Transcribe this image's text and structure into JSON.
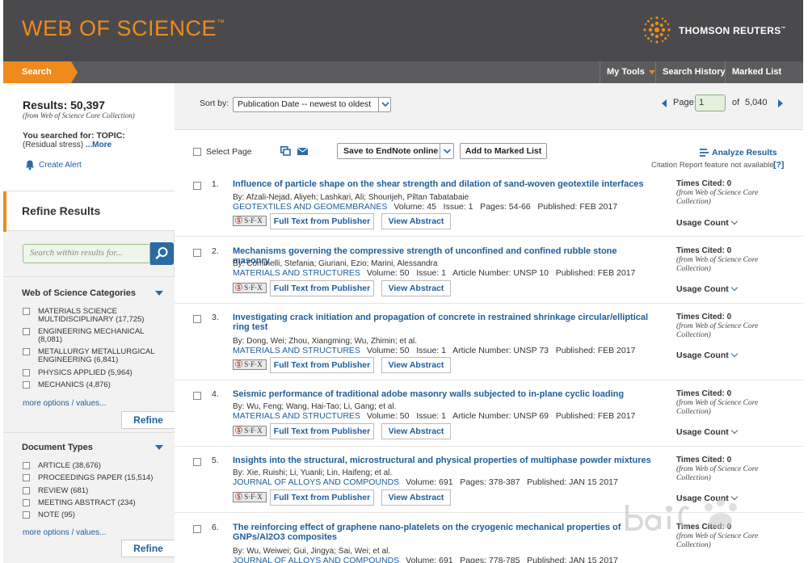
{
  "header": {
    "logo": "WEB OF SCIENCE",
    "logo_tm": "™",
    "publisher": "THOMSON REUTERS",
    "publisher_tm": "™"
  },
  "nav": {
    "search_tab": "Search",
    "my_tools": "My Tools",
    "search_history": "Search History",
    "marked_list": "Marked List"
  },
  "sidebar": {
    "results_label": "Results: 50,397",
    "results_from": "(from Web of Science Core Collection)",
    "searched_for": "You searched for: TOPIC:",
    "search_query": "(Residual stress)",
    "more_link": "...More",
    "create_alert": "Create Alert",
    "refine_title": "Refine Results",
    "within_placeholder": "Search within results for...",
    "categories": {
      "title": "Web of Science Categories",
      "items": [
        "MATERIALS SCIENCE MULTIDISCIPLINARY (17,725)",
        "ENGINEERING MECHANICAL (8,081)",
        "METALLURGY METALLURGICAL ENGINEERING (6,841)",
        "PHYSICS APPLIED (5,964)",
        "MECHANICS (4,876)"
      ],
      "more": "more options / values...",
      "refine": "Refine"
    },
    "doc_types": {
      "title": "Document Types",
      "items": [
        "ARTICLE (38,676)",
        "PROCEEDINGS PAPER (15,514)",
        "REVIEW (681)",
        "MEETING ABSTRACT (234)",
        "NOTE (95)"
      ],
      "more": "more options / values...",
      "refine": "Refine"
    }
  },
  "sort": {
    "label": "Sort by:",
    "selected": "Publication Date -- newest to oldest"
  },
  "pager": {
    "page_label": "Page",
    "current": "1",
    "of_label": "of",
    "total": "5,040"
  },
  "toolbar": {
    "select_page": "Select Page",
    "endnote": "Save to EndNote online",
    "marked_list": "Add to Marked List",
    "analyze": "Analyze Results",
    "citation_note": "Citation Report feature not available.",
    "help": "[?]"
  },
  "record_common": {
    "sfx": "S·F·X",
    "full_text": "Full Text from Publisher",
    "view_abstract": "View Abstract",
    "cited_from": "(from Web of Science Core Collection)",
    "usage_count": "Usage Count"
  },
  "records": [
    {
      "num": "1.",
      "title": "Influence of particle shape on the shear strength and dilation of sand-woven geotextile interfaces",
      "authors": "By: Afzali-Nejad, Aliyeh; Lashkari, Ali; Shourijeh, Piltan Tabatabaie",
      "journal": "GEOTEXTILES AND GEOMEMBRANES",
      "details": "Volume: 45   Issue: 1   Pages: 54-66   Published: FEB 2017",
      "cited": "Times Cited: 0"
    },
    {
      "num": "2.",
      "title": "Mechanisms governing the compressive strength of unconfined and confined rubble stone masonry",
      "authors": "By: Cominelli, Stefania; Giuriani, Ezio; Marini, Alessandra",
      "journal": "MATERIALS AND STRUCTURES",
      "details": "Volume: 50   Issue: 1   Article Number: UNSP 10   Published: FEB 2017",
      "cited": "Times Cited: 0"
    },
    {
      "num": "3.",
      "title": "Investigating crack initiation and propagation of concrete in restrained shrinkage circular/elliptical ring test",
      "authors": "By: Dong, Wei; Zhou, Xiangming; Wu, Zhimin; et al.",
      "journal": "MATERIALS AND STRUCTURES",
      "details": "Volume: 50   Issue: 1   Article Number: UNSP 73   Published: FEB 2017",
      "cited": "Times Cited: 0"
    },
    {
      "num": "4.",
      "title": "Seismic performance of traditional adobe masonry walls subjected to in-plane cyclic loading",
      "authors": "By: Wu, Feng; Wang, Hai-Tao; Li, Gang; et al.",
      "journal": "MATERIALS AND STRUCTURES",
      "details": "Volume: 50   Issue: 1   Article Number: UNSP 69   Published: FEB 2017",
      "cited": "Times Cited: 0"
    },
    {
      "num": "5.",
      "title": "Insights into the structural, microstructural and physical properties of multiphase powder mixtures",
      "authors": "By: Xie, Ruishi; Li, Yuanli; Lin, Haifeng; et al.",
      "journal": "JOURNAL OF ALLOYS AND COMPOUNDS",
      "details": "Volume: 691   Pages: 378-387   Published: JAN 15 2017",
      "cited": "Times Cited: 0"
    },
    {
      "num": "6.",
      "title": "The reinforcing effect of graphene nano-platelets on the cryogenic mechanical properties of GNPs/Al2O3 composites",
      "authors": "By: Wu, Weiwei; Gui, Jingya; Sai, Wei; et al.",
      "journal": "JOURNAL OF ALLOYS AND COMPOUNDS",
      "details": "Volume: 691   Pages: 778-785   Published: JAN 15 2017",
      "cited": "Times Cited: 0"
    }
  ],
  "colors": {
    "header_bg": "#4a4a4c",
    "brand_orange": "#f08a1c",
    "link_blue": "#1e5e9a"
  }
}
